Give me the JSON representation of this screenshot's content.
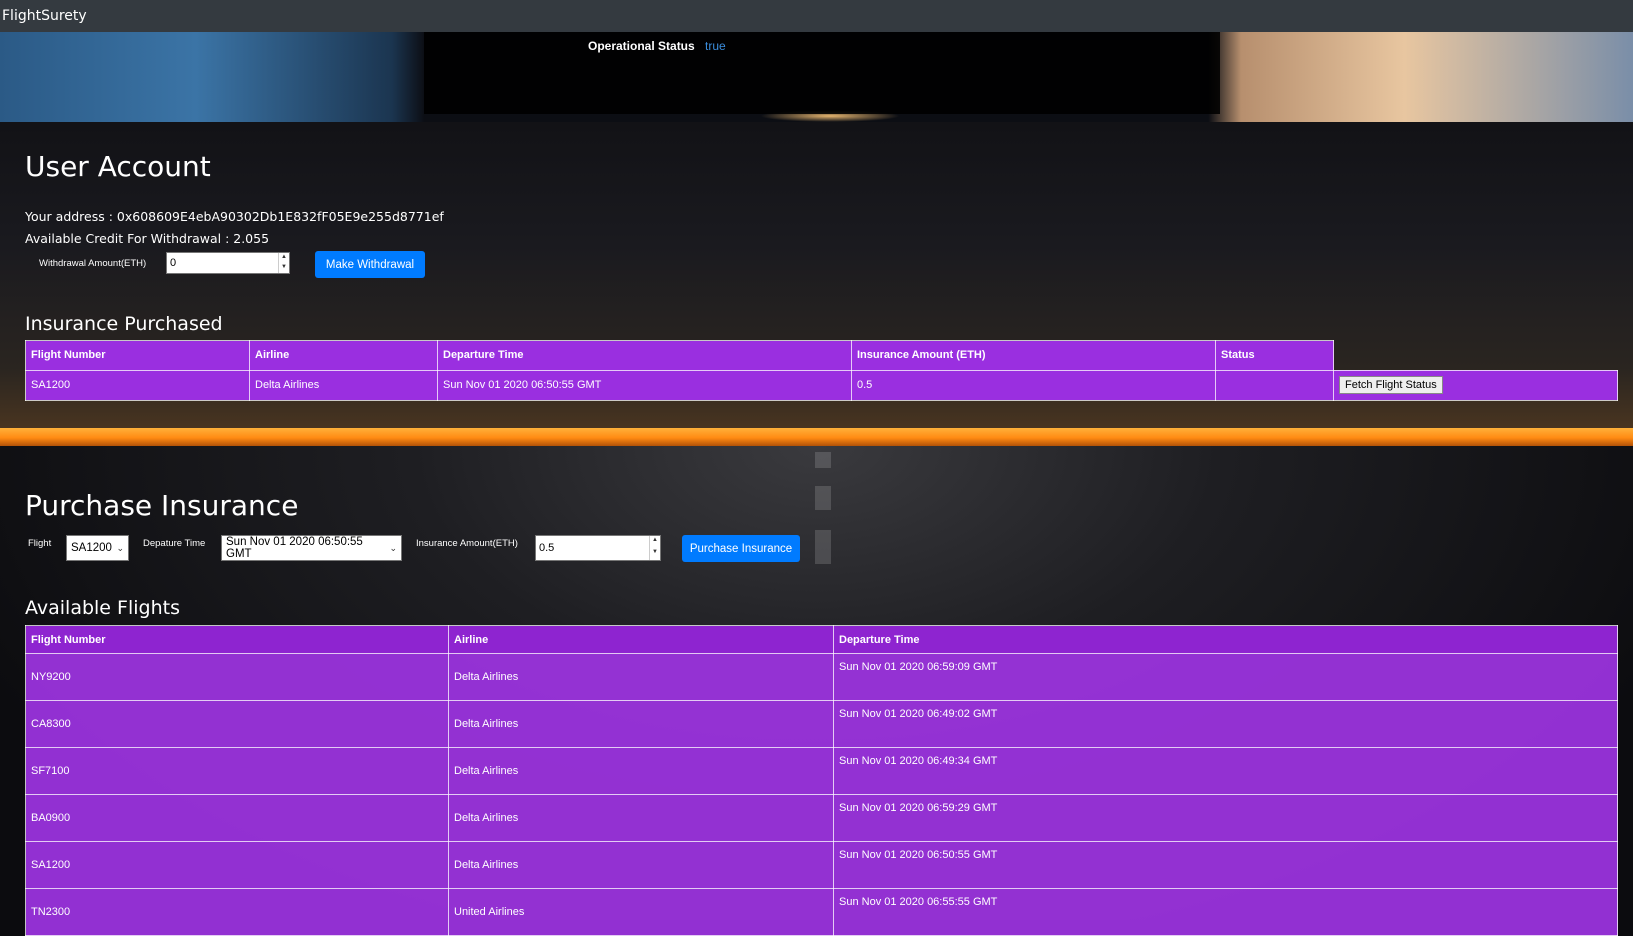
{
  "app": {
    "title": "FlightSurety"
  },
  "operational": {
    "label": "Operational Status",
    "value": "true"
  },
  "account": {
    "heading": "User Account",
    "address_line": "Your address : 0x608609E4ebA90302Db1E832fF05E9e255d8771ef",
    "credit_line": "Available Credit For Withdrawal : 2.055",
    "withdraw_label": "Withdrawal Amount(ETH)",
    "withdraw_value": "0",
    "withdraw_button": "Make Withdrawal"
  },
  "insurance_purchased": {
    "heading": "Insurance Purchased",
    "columns": [
      "Flight Number",
      "Airline",
      "Departure Time",
      "Insurance Amount (ETH)",
      "Status"
    ],
    "rows": [
      {
        "flight": "SA1200",
        "airline": "Delta Airlines",
        "departure": "Sun Nov 01 2020 06:50:55 GMT",
        "amount": "0.5",
        "status": "",
        "action": "Fetch Flight Status"
      }
    ]
  },
  "purchase": {
    "heading": "Purchase Insurance",
    "flight_label": "Flight",
    "flight_value": "SA1200",
    "departure_label": "Depature Time",
    "departure_value": "Sun Nov 01 2020 06:50:55 GMT",
    "amount_label": "Insurance Amount(ETH)",
    "amount_value": "0.5",
    "button": "Purchase Insurance"
  },
  "available_flights": {
    "heading": "Available Flights",
    "columns": [
      "Flight Number",
      "Airline",
      "Departure Time"
    ],
    "rows": [
      {
        "flight": "NY9200",
        "airline": "Delta Airlines",
        "departure": "Sun Nov 01 2020 06:59:09 GMT"
      },
      {
        "flight": "CA8300",
        "airline": "Delta Airlines",
        "departure": "Sun Nov 01 2020 06:49:02 GMT"
      },
      {
        "flight": "SF7100",
        "airline": "Delta Airlines",
        "departure": "Sun Nov 01 2020 06:49:34 GMT"
      },
      {
        "flight": "BA0900",
        "airline": "Delta Airlines",
        "departure": "Sun Nov 01 2020 06:59:29 GMT"
      },
      {
        "flight": "SA1200",
        "airline": "Delta Airlines",
        "departure": "Sun Nov 01 2020 06:50:55 GMT"
      },
      {
        "flight": "TN2300",
        "airline": "United Airlines",
        "departure": "Sun Nov 01 2020 06:55:55 GMT"
      }
    ]
  }
}
